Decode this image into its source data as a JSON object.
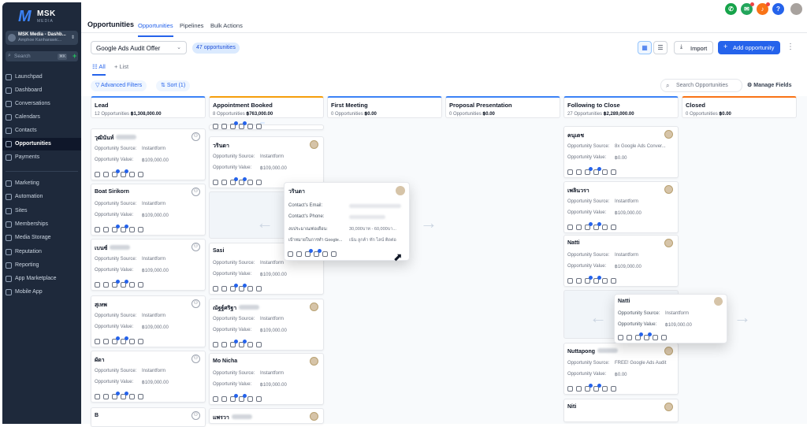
{
  "brand": {
    "name": "MSK",
    "sub": "MEDIA"
  },
  "account": {
    "name": "MSK Media - Dashb...",
    "sub": "Amphoe Kanharawic..."
  },
  "sidebar_search": {
    "placeholder": "Search",
    "shortcut": "⌘K"
  },
  "nav": [
    {
      "label": "Launchpad",
      "icon": "rocket-icon"
    },
    {
      "label": "Dashboard",
      "icon": "dashboard-icon"
    },
    {
      "label": "Conversations",
      "icon": "chat-icon"
    },
    {
      "label": "Calendars",
      "icon": "calendar-icon"
    },
    {
      "label": "Contacts",
      "icon": "contacts-icon"
    },
    {
      "label": "Opportunities",
      "icon": "opportunities-icon",
      "active": true
    },
    {
      "label": "Payments",
      "icon": "payments-icon"
    }
  ],
  "nav2": [
    {
      "label": "Marketing",
      "icon": "marketing-icon"
    },
    {
      "label": "Automation",
      "icon": "automation-icon"
    },
    {
      "label": "Sites",
      "icon": "sites-icon"
    },
    {
      "label": "Memberships",
      "icon": "memberships-icon"
    },
    {
      "label": "Media Storage",
      "icon": "media-storage-icon"
    },
    {
      "label": "Reputation",
      "icon": "reputation-icon"
    },
    {
      "label": "Reporting",
      "icon": "reporting-icon"
    },
    {
      "label": "App Marketplace",
      "icon": "marketplace-icon"
    },
    {
      "label": "Mobile App",
      "icon": "mobile-icon"
    }
  ],
  "header": {
    "title": "Opportunities",
    "tabs": [
      "Opportunities",
      "Pipelines",
      "Bulk Actions"
    ],
    "top_icons": [
      {
        "name": "phone-icon",
        "glyph": "✆",
        "color": "#16a34a"
      },
      {
        "name": "megaphone-icon",
        "glyph": "✉",
        "color": "#22a55b"
      },
      {
        "name": "bell-icon",
        "glyph": "♪",
        "color": "#f97316"
      },
      {
        "name": "help-icon",
        "glyph": "?",
        "color": "#2563eb"
      }
    ]
  },
  "toolbar": {
    "pipeline": "Google Ads Audit Offer",
    "count": "47 opportunities",
    "import": "Import",
    "add": "Add opportunity",
    "subtabs": [
      "All",
      "List"
    ],
    "advanced_filters": "Advanced Filters",
    "sort": "Sort (1)",
    "search_placeholder": "Search Opportunities",
    "manage_fields": "Manage Fields"
  },
  "labels": {
    "source": "Opportunity Source:",
    "value": "Opportunity Value:"
  },
  "columns": [
    {
      "title": "Lead",
      "count": "12 Opportunities",
      "total": "฿1,308,000.00"
    },
    {
      "title": "Appointment Booked",
      "count": "8 Opportunities",
      "total": "฿763,000.00"
    },
    {
      "title": "First Meeting",
      "count": "0 Opportunities",
      "total": "฿0.00"
    },
    {
      "title": "Proposal Presentation",
      "count": "0 Opportunities",
      "total": "฿0.00"
    },
    {
      "title": "Following to Close",
      "count": "27 Opportunities",
      "total": "฿2,289,000.00"
    },
    {
      "title": "Closed",
      "count": "0 Opportunities",
      "total": "฿0.00"
    }
  ],
  "lead_cards": [
    {
      "name": "วุฒินันท์",
      "source": "Instantform",
      "value": "฿109,000.00"
    },
    {
      "name": "Boat Sirikorn",
      "source": "Instantform",
      "value": "฿109,000.00"
    },
    {
      "name": "เบนซ์",
      "source": "Instantform",
      "value": "฿109,000.00"
    },
    {
      "name": "สุเทพ",
      "source": "Instantform",
      "value": "฿109,000.00"
    },
    {
      "name": "ผัดา",
      "source": "Instantform",
      "value": "฿109,000.00"
    },
    {
      "name": "B",
      "source": "",
      "value": ""
    }
  ],
  "appt_cards": [
    {
      "name": "วรินดา",
      "source": "Instantform",
      "value": "฿109,000.00"
    },
    {
      "name": "Sasi",
      "source": "Instantform",
      "value": "฿109,000.00"
    },
    {
      "name": "ณัฐฐ์ศริฐา",
      "source": "Instantform",
      "value": "฿109,000.00"
    },
    {
      "name": "Mo Nicha",
      "source": "Instantform",
      "value": "฿109,000.00"
    },
    {
      "name": "แพรวา",
      "source": "",
      "value": ""
    }
  ],
  "follow_cards": [
    {
      "name": "คนุเดช",
      "source": "8x Google Ads Conver...",
      "value": "฿0.00"
    },
    {
      "name": "เพลินวรา",
      "source": "Instantform",
      "value": "฿109,000.00"
    },
    {
      "name": "Natti",
      "source": "Instantform",
      "value": "฿109,000.00"
    },
    {
      "name": "Nuttapong",
      "source": "FREE! Google Ads Audit",
      "value": "฿0.00"
    },
    {
      "name": "Niti",
      "source": "",
      "value": ""
    }
  ],
  "drag1": {
    "name": "วรินดา",
    "email_label": "Contact's Email:",
    "phone_label": "Contact's Phone:",
    "budget_label": "งบประมาณ/ต่อเดือน:",
    "budget_value": "30,000บาท - 60,000บา...",
    "goal_label": "เป้าหมายในการทำ Google...",
    "goal_value": "เน้น ลูกค้า ทัก ไลน์ ติดต่อ"
  },
  "drag2": {
    "name": "Natti",
    "source": "Instantform",
    "value": "฿109,000.00"
  }
}
